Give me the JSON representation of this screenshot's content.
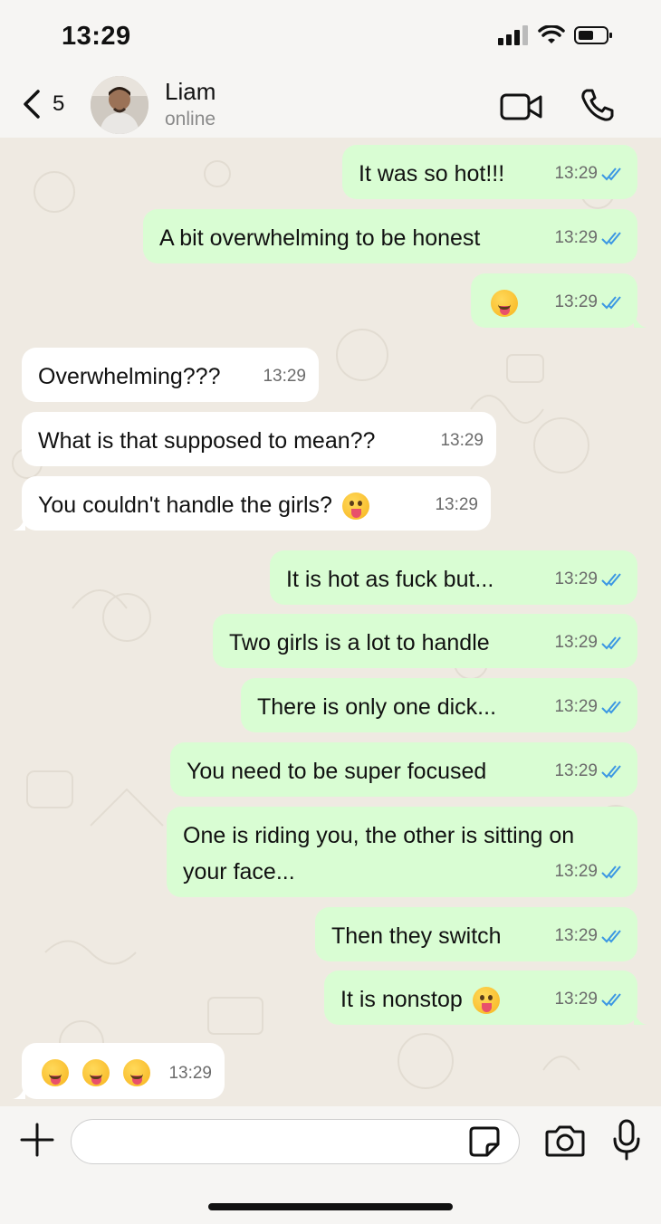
{
  "status_bar": {
    "time": "13:29"
  },
  "header": {
    "back_count": "5",
    "contact_name": "Liam",
    "contact_status": "online"
  },
  "messages": [
    {
      "dir": "out",
      "text": "It was so hot!!!",
      "time": "13:29",
      "read": true
    },
    {
      "dir": "out",
      "text": "A bit overwhelming to be honest",
      "time": "13:29",
      "read": true
    },
    {
      "dir": "out",
      "text": "",
      "emoji": "squinting-face-with-tongue",
      "time": "13:29",
      "read": true
    },
    {
      "dir": "in",
      "text": "Overwhelming???",
      "time": "13:29"
    },
    {
      "dir": "in",
      "text": "What is that supposed to mean??",
      "time": "13:29"
    },
    {
      "dir": "in",
      "text": "You couldn't handle the girls?",
      "emoji": "zany-face",
      "time": "13:29"
    },
    {
      "dir": "out",
      "text": "It is hot as fuck but...",
      "time": "13:29",
      "read": true
    },
    {
      "dir": "out",
      "text": "Two girls is a lot to handle",
      "time": "13:29",
      "read": true
    },
    {
      "dir": "out",
      "text": "There is only one dick...",
      "time": "13:29",
      "read": true
    },
    {
      "dir": "out",
      "text": "You need to be super focused",
      "time": "13:29",
      "read": true
    },
    {
      "dir": "out",
      "text": "One is riding you, the other is sitting on your face...",
      "line1": "One is riding you, the other is sitting on",
      "line2": "your face...",
      "time": "13:29",
      "read": true
    },
    {
      "dir": "out",
      "text": "Then they switch",
      "time": "13:29",
      "read": true
    },
    {
      "dir": "out",
      "text": "It is nonstop",
      "emoji": "winking-face-with-tongue",
      "time": "13:29",
      "read": true
    },
    {
      "dir": "in",
      "text": "",
      "emoji": "squinting-face-with-tongue x3",
      "time": "13:29"
    }
  ],
  "input": {
    "placeholder": ""
  },
  "colors": {
    "outgoing": "#d9fdd3",
    "incoming": "#ffffff",
    "read_tick": "#3b97e3",
    "chat_bg": "#efeae2"
  },
  "icons": [
    "back-chevron-icon",
    "video-call-icon",
    "phone-icon",
    "plus-icon",
    "sticker-icon",
    "camera-icon",
    "mic-icon"
  ]
}
